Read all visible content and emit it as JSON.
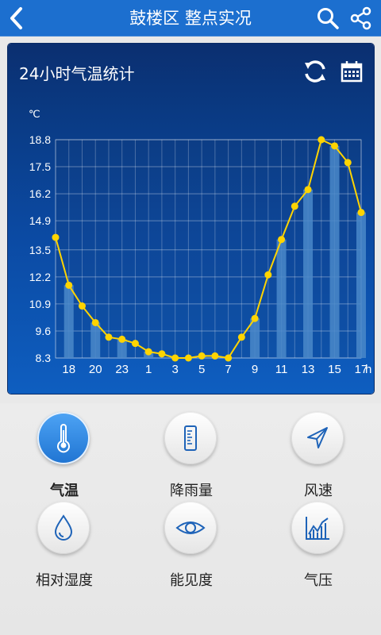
{
  "header": {
    "title": "鼓楼区 整点实况"
  },
  "panel": {
    "title": "24小时气温统计"
  },
  "chart_data": {
    "type": "bar+line",
    "unit": "℃",
    "x_axis_unit": "h",
    "ylim": [
      8.3,
      18.8
    ],
    "yticks": [
      8.3,
      9.6,
      10.9,
      12.2,
      13.5,
      14.9,
      16.2,
      17.5,
      18.8
    ],
    "xtick_labels": [
      "18",
      "20",
      "23",
      "1",
      "3",
      "5",
      "7",
      "9",
      "11",
      "13",
      "15",
      "17"
    ],
    "series": [
      {
        "values": [
          14.1,
          11.8,
          10.8,
          10.0,
          9.3,
          9.2,
          9.0,
          8.6,
          8.5,
          8.3,
          8.3,
          8.4,
          8.4,
          8.3,
          9.3,
          10.2,
          12.3,
          14.0,
          15.6,
          16.4,
          18.8,
          18.5,
          17.7,
          15.3
        ]
      }
    ],
    "grid": true,
    "colors": {
      "line": "#ffd400",
      "bar": "#4a88c9"
    }
  },
  "metrics": [
    {
      "label": "气温",
      "icon": "thermometer-icon",
      "active": true
    },
    {
      "label": "降雨量",
      "icon": "rain-gauge-icon",
      "active": false
    },
    {
      "label": "风速",
      "icon": "wind-arrow-icon",
      "active": false
    },
    {
      "label": "相对湿度",
      "icon": "water-drop-icon",
      "active": false
    },
    {
      "label": "能见度",
      "icon": "eye-icon",
      "active": false
    },
    {
      "label": "气压",
      "icon": "pressure-chart-icon",
      "active": false
    }
  ]
}
